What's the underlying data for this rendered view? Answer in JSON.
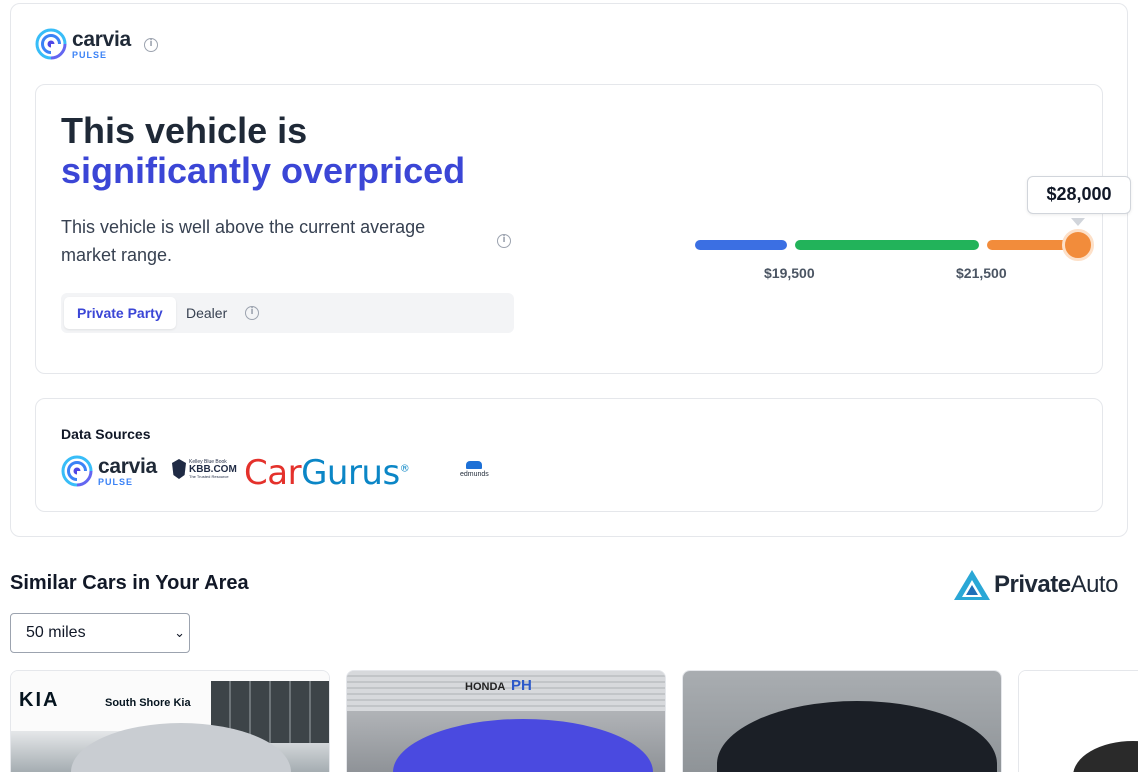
{
  "brand": {
    "name": "carvia",
    "sub": "PULSE",
    "info_icon": "info-icon"
  },
  "verdict": {
    "line1": "This vehicle is",
    "line2": "significantly overpriced",
    "description": "This vehicle is well above the current average market range.",
    "accent_color": "#3b46d6"
  },
  "seller_tabs": {
    "tabs": [
      "Private Party",
      "Dealer"
    ],
    "selected": "Private Party"
  },
  "price_range": {
    "ticks": [
      "$19,500",
      "$21,500"
    ],
    "current_price": "$28,000",
    "segments": [
      {
        "name": "below",
        "color": "#3b6fe3"
      },
      {
        "name": "fair",
        "color": "#22b35a"
      },
      {
        "name": "above",
        "color": "#f28c3b"
      }
    ]
  },
  "data_sources": {
    "title": "Data Sources",
    "logos": {
      "carvia": {
        "name": "carvia",
        "sub": "PULSE"
      },
      "kbb": {
        "line1": "Kelley Blue Book",
        "line2": "KBB.COM",
        "line3": "The Trusted Resource"
      },
      "cargurus": {
        "part1": "Car",
        "part2": "Gurus",
        "mark": "®"
      },
      "edmunds": {
        "name": "edmunds"
      }
    }
  },
  "similar": {
    "title": "Similar Cars in Your Area",
    "partner": {
      "bold": "Private",
      "rest": "Auto"
    },
    "radius": {
      "selected": "50 miles"
    },
    "listings": [
      {
        "dealer_brand": "KIA",
        "dealer_name": "South Shore Kia",
        "car_color": "#c9cdd2"
      },
      {
        "dealer_brand": "HONDA",
        "dealer_name": "PH",
        "car_color": "#4a4ae0"
      },
      {
        "dealer_brand": "",
        "dealer_name": "",
        "car_color": "#1b1f26"
      },
      {
        "dealer_brand": "",
        "dealer_name": "",
        "car_color": "#2a2a2a"
      }
    ]
  }
}
